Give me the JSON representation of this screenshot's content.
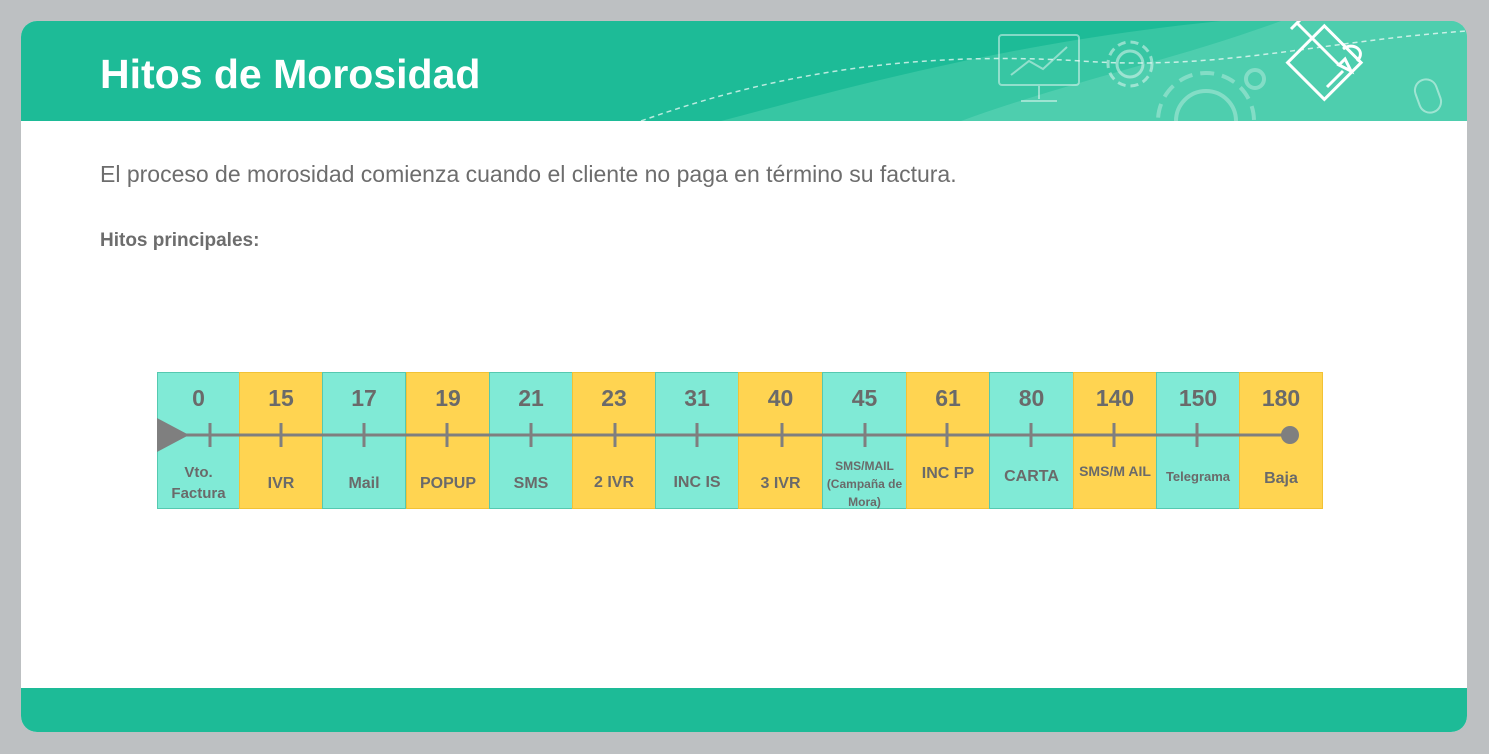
{
  "header": {
    "title": "Hitos de Morosidad"
  },
  "intro_text": "El proceso de morosidad comienza cuando el cliente no paga en término su factura.",
  "subtitle": "Hitos principales:",
  "header_icons": [
    "presentation-icon",
    "gear-icon",
    "gears-icon",
    "document-edit-icon",
    "mouse-icon"
  ],
  "colors": {
    "brand_green": "#1dbb97",
    "cell_mint": "#80ead6",
    "cell_yellow": "#ffd451",
    "text_gray": "#6d6d6d",
    "axis_gray": "#7f7f7f",
    "background": "#bdc0c2"
  },
  "timeline": [
    {
      "day": "0",
      "label": "Vto. Factura",
      "color": "mint"
    },
    {
      "day": "15",
      "label": "IVR",
      "color": "yellow"
    },
    {
      "day": "17",
      "label": "Mail",
      "color": "mint"
    },
    {
      "day": "19",
      "label": "POPUP",
      "color": "yellow"
    },
    {
      "day": "21",
      "label": "SMS",
      "color": "mint"
    },
    {
      "day": "23",
      "label": "2 IVR",
      "color": "yellow"
    },
    {
      "day": "31",
      "label": "INC IS",
      "color": "mint"
    },
    {
      "day": "40",
      "label": "3 IVR",
      "color": "yellow"
    },
    {
      "day": "45",
      "label": "SMS/MAIL (Campaña de Mora)",
      "color": "mint"
    },
    {
      "day": "61",
      "label": "INC FP",
      "color": "yellow"
    },
    {
      "day": "80",
      "label": "CARTA",
      "color": "mint"
    },
    {
      "day": "140",
      "label": "SMS/M AIL",
      "color": "yellow"
    },
    {
      "day": "150",
      "label": "Telegrama",
      "color": "mint"
    },
    {
      "day": "180",
      "label": "Baja",
      "color": "yellow"
    }
  ]
}
